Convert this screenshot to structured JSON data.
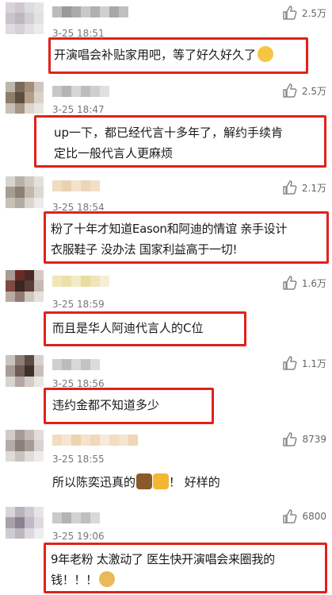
{
  "comments": [
    {
      "time": "3-25 18:51",
      "likes": "2.5万",
      "lines": [
        "开演唱会补贴家用吧，等了好久好久了"
      ],
      "emoji": "crying-face"
    },
    {
      "time": "3-25 18:47",
      "likes": "2.5万",
      "lines": [
        "up一下，都已经代言十多年了，解约手续肯",
        "定比一般代言人更麻烦"
      ]
    },
    {
      "time": "3-25 18:54",
      "likes": "2.1万",
      "lines": [
        "粉了十年才知道Eason和阿迪的情谊 亲手设计",
        "衣服鞋子 没办法 国家利益高于一切!"
      ]
    },
    {
      "time": "3-25 18:59",
      "likes": "1.6万",
      "lines": [
        "而且是华人阿迪代言人的C位"
      ]
    },
    {
      "time": "3-25 18:56",
      "likes": "1.1万",
      "lines": [
        "违约金都不知道多少"
      ]
    },
    {
      "time": "3-25 18:55",
      "likes": "8739",
      "lines": [
        "所以陈奕迅真的",
        "！ 好样的"
      ],
      "emoji": "bull-beer"
    },
    {
      "time": "3-25 19:06",
      "likes": "6800",
      "lines": [
        "9年老粉 太激动了 医生快开演唱会来圈我的",
        "钱！！！"
      ],
      "emoji": "doge"
    }
  ],
  "colors": {
    "highlight": "#e0221a",
    "time": "#777777",
    "like": "#666666"
  },
  "icons": {
    "like": "thumbs-up-icon"
  }
}
